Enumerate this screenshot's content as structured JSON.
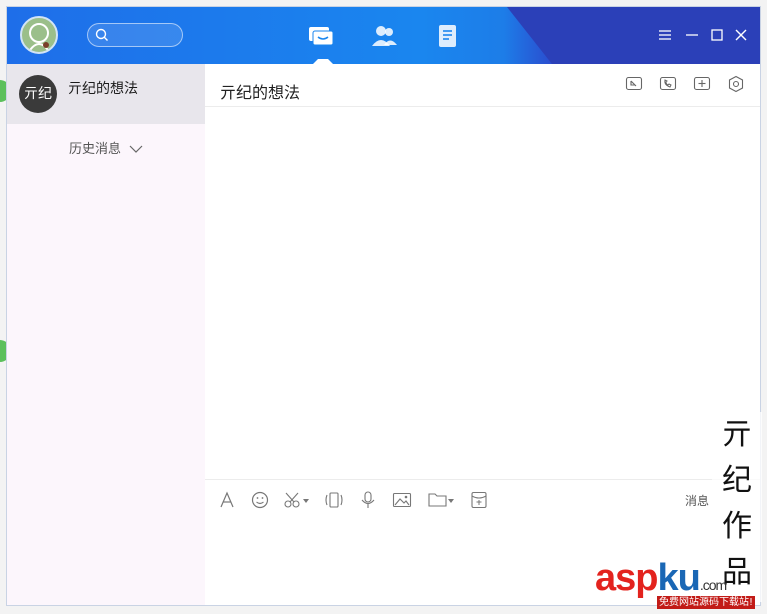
{
  "window": {
    "nav_tabs": [
      "message-icon",
      "contacts-icon",
      "apps-icon"
    ]
  },
  "contact": {
    "name": "亓纪的想法",
    "avatar_text": "亓纪"
  },
  "sidebar": {
    "history_label": "历史消息"
  },
  "chat": {
    "title": "亓纪的想法",
    "header_icons": [
      "screen-share-icon",
      "voice-call-icon",
      "add-member-icon",
      "settings-icon"
    ],
    "toolbar_icons": [
      "font-icon",
      "emoji-icon",
      "screenshot-icon",
      "shake-icon",
      "voice-icon",
      "image-icon",
      "file-icon",
      "red-packet-icon"
    ],
    "message_record_label": "消息"
  },
  "watermark": {
    "chars": [
      "亓",
      "纪",
      "作",
      "品"
    ],
    "logo_asp": "asp",
    "logo_ku": "ku",
    "logo_com": ".com",
    "logo_sub": "免费网站源码下载站!"
  },
  "colors": {
    "titlebar": "#1a86ef",
    "titlebar_dark": "#2b40b8",
    "sidebar_bg": "#fcf6fc",
    "selected_row": "#e8e6ec"
  }
}
